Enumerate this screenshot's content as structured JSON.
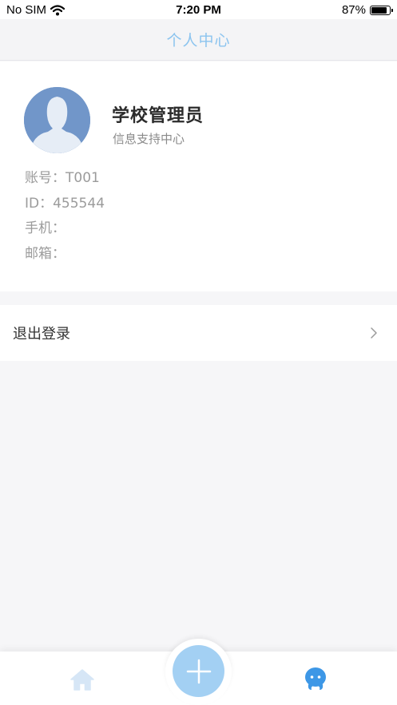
{
  "status_bar": {
    "carrier": "No SIM",
    "time": "7:20 PM",
    "battery": "87%",
    "battery_level": 0.87,
    "icons": [
      "wifi-icon",
      "battery-icon"
    ]
  },
  "nav": {
    "title": "个人中心"
  },
  "profile": {
    "name": "学校管理员",
    "org": "信息支持中心",
    "avatar_icon": "default-avatar-icon",
    "info": [
      {
        "label": "账号：",
        "value": "T001"
      },
      {
        "label": "ID：",
        "value": "455544"
      },
      {
        "label": "手机：",
        "value": ""
      },
      {
        "label": "邮箱：",
        "value": ""
      }
    ]
  },
  "menu": {
    "logout_label": "退出登录",
    "chevron_icon": "chevron-right-icon"
  },
  "tab_bar": {
    "items": [
      "home-icon",
      "add-icon",
      "chat-icon"
    ],
    "colors": {
      "home": "#d6e6f6",
      "fab": "#a3d0f3",
      "chat": "#3d97e6"
    }
  },
  "colors": {
    "accent": "#8cc4ef",
    "background": "#f6f6f8"
  }
}
